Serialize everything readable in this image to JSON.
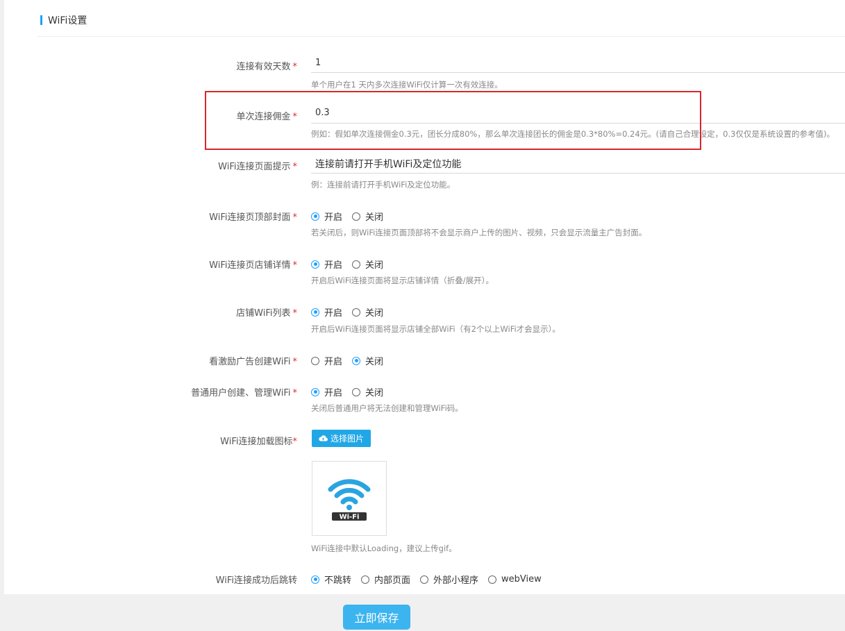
{
  "section": {
    "title": "WiFi设置"
  },
  "fields": {
    "valid_days": {
      "label": "连接有效天数",
      "value": "1",
      "help": "单个用户在1 天内多次连接WiFi仅计算一次有效连接。"
    },
    "commission": {
      "label": "单次连接佣金",
      "value": "0.3",
      "help": "例如：假如单次连接佣金0.3元，团长分成80%，那么单次连接团长的佣金是0.3*80%=0.24元。(请自己合理设定，0.3仅仅是系统设置的参考值)。"
    },
    "page_tip": {
      "label": "WiFi连接页面提示",
      "value": "连接前请打开手机WiFi及定位功能",
      "help": "例：连接前请打开手机WiFi及定位功能。"
    },
    "top_cover": {
      "label": "WiFi连接页顶部封面",
      "options": [
        "开启",
        "关闭"
      ],
      "selected": "开启",
      "help": "若关闭后，则WiFi连接页面顶部将不会显示商户上传的图片、视频，只会显示流量主广告封面。"
    },
    "shop_detail": {
      "label": "WiFi连接页店铺详情",
      "options": [
        "开启",
        "关闭"
      ],
      "selected": "开启",
      "help": "开启后WiFi连接页面将显示店铺详情（折叠/展开）。"
    },
    "shop_wifi_list": {
      "label": "店铺WiFi列表",
      "options": [
        "开启",
        "关闭"
      ],
      "selected": "开启",
      "help": "开启后WiFi连接页面将显示店铺全部WiFi（有2个以上WiFi才会显示）。"
    },
    "ad_create": {
      "label": "看激励广告创建WiFi",
      "options": [
        "开启",
        "关闭"
      ],
      "selected": "关闭"
    },
    "user_manage": {
      "label": "普通用户创建、管理WiFi",
      "options": [
        "开启",
        "关闭"
      ],
      "selected": "开启",
      "help": "关闭后普通用户将无法创建和管理WiFi码。"
    },
    "loading_icon": {
      "label": "WiFi连接加载图标",
      "button": "选择图片",
      "image_text": "Wi-Fi",
      "help": "WiFi连接中默认Loading，建议上传gif。"
    },
    "after_jump": {
      "label": "WiFi连接成功后跳转",
      "options": [
        "不跳转",
        "内部页面",
        "外部小程序",
        "webView"
      ],
      "selected": "不跳转"
    }
  },
  "required_mark": "*",
  "save_label": "立即保存",
  "colors": {
    "accent": "#1e9fff",
    "button": "#22a7e6",
    "save": "#3cb4ef",
    "required": "#e02a2a",
    "highlight": "#d9262c"
  }
}
